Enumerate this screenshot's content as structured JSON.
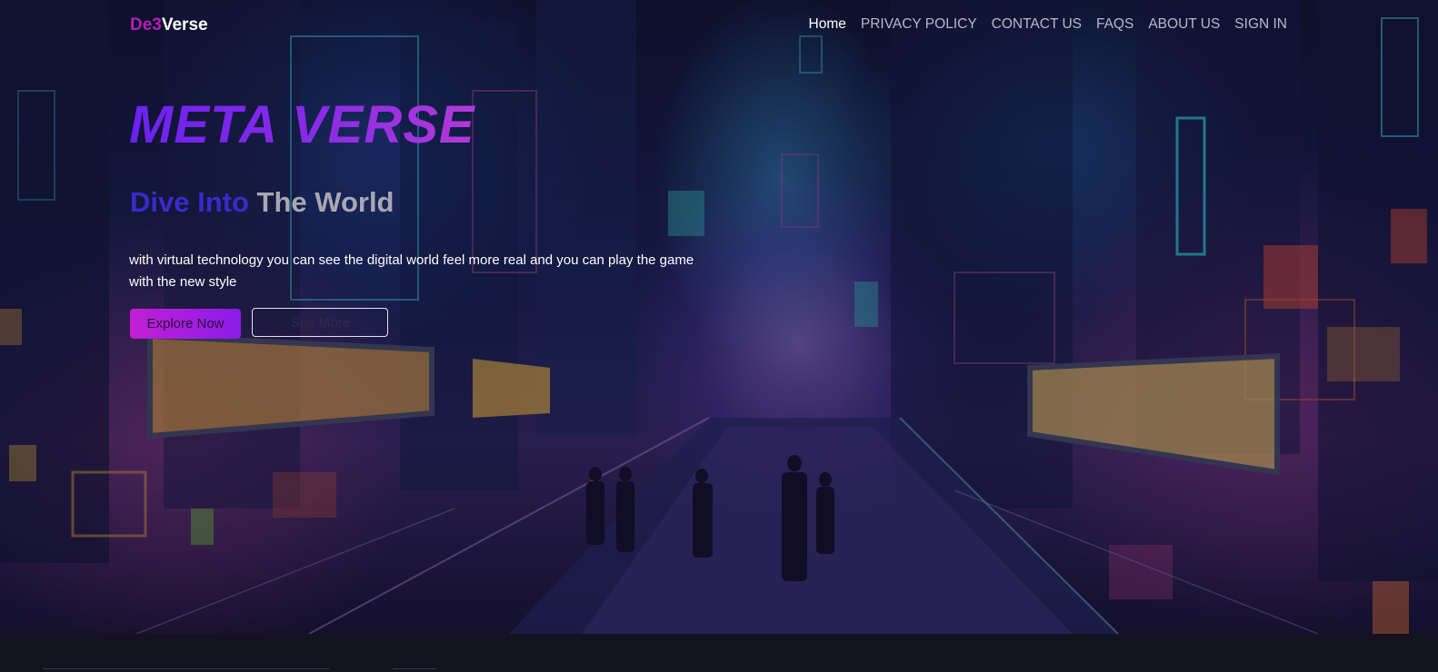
{
  "brand": {
    "part1": "De3",
    "part2": "Verse"
  },
  "nav": {
    "items": [
      "Home",
      "PRIVACY POLICY",
      "CONTACT US",
      "FAQS",
      "ABOUT US",
      "SIGN IN"
    ],
    "active": "Home"
  },
  "hero": {
    "title": "META VERSE",
    "subtitle_part1": "Dive Into ",
    "subtitle_part2": "The World",
    "description": "with virtual technology you can see the digital world feel more real and you can play the game with the new style",
    "explore_label": "Explore Now",
    "see_more_label": "See More"
  },
  "colors": {
    "brand_magenta": "#b21fb8",
    "title_gradient_start": "#6a22f0",
    "title_gradient_end": "#b23ad8",
    "subtitle_blue": "#3b29c9",
    "button_gradient_start": "#c21fd4",
    "button_gradient_end": "#8a1de8",
    "footer_bg": "#13121f"
  }
}
